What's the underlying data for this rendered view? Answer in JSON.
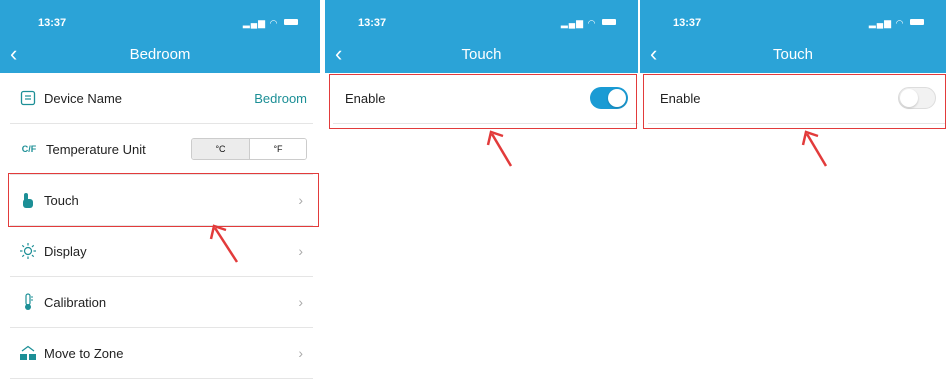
{
  "screens": [
    {
      "status": {
        "time": "13:37"
      },
      "title": "Bedroom",
      "rows": [
        {
          "icon": "list-icon",
          "label": "Device Name",
          "value": "Bedroom"
        },
        {
          "icon": "temperature-unit-icon",
          "icon_text": "C/F",
          "label": "Temperature Unit",
          "segments": [
            "°C",
            "°F"
          ],
          "selected": "°F"
        },
        {
          "icon": "touch-icon",
          "label": "Touch"
        },
        {
          "icon": "sun-icon",
          "label": "Display"
        },
        {
          "icon": "thermometer-icon",
          "label": "Calibration"
        },
        {
          "icon": "zone-icon",
          "label": "Move to Zone"
        }
      ],
      "chevron": "›"
    },
    {
      "status": {
        "time": "13:37"
      },
      "title": "Touch",
      "enable_label": "Enable",
      "enable_state": true
    },
    {
      "status": {
        "time": "13:37"
      },
      "title": "Touch",
      "enable_label": "Enable",
      "enable_state": false
    }
  ],
  "colors": {
    "header": "#2ba3d7",
    "accent": "#1a9bd4",
    "value_text": "#1c8f96",
    "highlight": "#e23b3b"
  }
}
